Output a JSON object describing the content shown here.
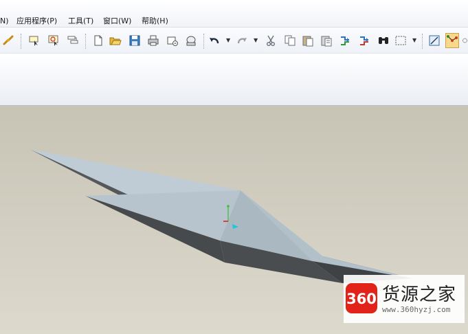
{
  "menu": {
    "partial_first": "N)",
    "items": [
      "应用程序(P)",
      "工具(T)",
      "窗口(W)",
      "帮助(H)"
    ]
  },
  "toolbar": {
    "icons": [
      "link-icon",
      "select-filter-icon",
      "edit-select-icon",
      "layer-icon",
      "new-file-icon",
      "open-file-icon",
      "save-icon",
      "print-icon",
      "send-icon",
      "mail-icon",
      "undo-icon",
      "redo-icon",
      "cut-icon",
      "copy-icon",
      "paste-icon",
      "paste-special-icon",
      "regenerate-icon",
      "regenerate-manager-icon",
      "find-icon",
      "selection-box-icon",
      "sketch-icon",
      "datum-icon"
    ]
  },
  "watermark": {
    "logo_text": "360",
    "title": "货源之家",
    "url": "www.360hyzj.com"
  },
  "colors": {
    "viewport": "#cfccbf",
    "model_light": "#b9c6cf",
    "model_shadow": "#4a4d50",
    "logo_red": "#e2231a"
  }
}
